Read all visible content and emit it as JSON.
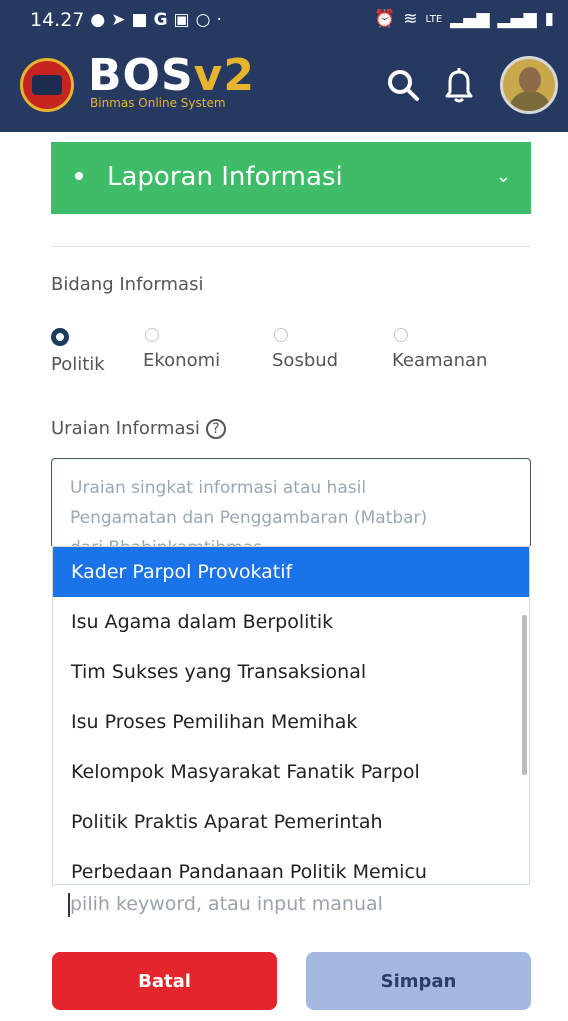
{
  "status_bar": {
    "time": "14.27"
  },
  "app": {
    "name_main": "BOS",
    "name_version": "v2",
    "subtitle": "Binmas Online System"
  },
  "accordion": {
    "label": "Laporan Informasi"
  },
  "bidang": {
    "label": "Bidang Informasi",
    "options": [
      {
        "label": "Politik",
        "checked": true
      },
      {
        "label": "Ekonomi",
        "checked": false
      },
      {
        "label": "Sosbud",
        "checked": false
      },
      {
        "label": "Keamanan",
        "checked": false
      }
    ]
  },
  "uraian": {
    "label": "Uraian Informasi",
    "help_icon_glyph": "?",
    "placeholder_line1": "Uraian singkat informasi atau hasil",
    "placeholder_line2": "Pengamatan dan Penggambaran (Matbar)",
    "placeholder_line3": "dari Bhabinkamtibmas"
  },
  "dropdown": {
    "options": [
      "Kader Parpol Provokatif",
      "Isu Agama dalam Berpolitik",
      "Tim Sukses yang Transaksional",
      "Isu Proses Pemilihan Memihak",
      "Kelompok Masyarakat Fanatik Parpol",
      "Politik Praktis Aparat Pemerintah",
      "Perbedaan Pandanaan Politik Memicu"
    ],
    "selected_index": 0,
    "keyword_placeholder": "pilih keyword, atau input manual"
  },
  "buttons": {
    "cancel": "Batal",
    "save": "Simpan"
  },
  "colors": {
    "header": "#263a61",
    "accent_green": "#3ebc68",
    "selected_blue": "#1a73e8",
    "danger": "#e4262c",
    "save_disabled": "#a3b9df"
  }
}
